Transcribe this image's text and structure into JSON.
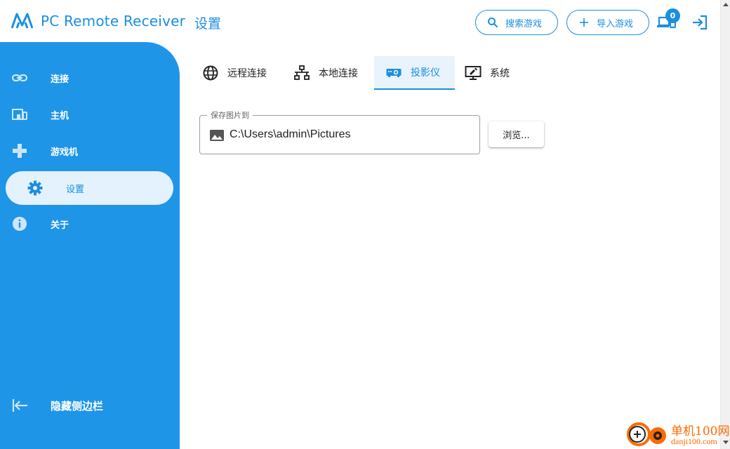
{
  "header": {
    "app_title": "PC Remote Receiver",
    "page_title": "设置",
    "search_games_label": "搜索游戏",
    "import_games_label": "导入游戏",
    "devices_badge_count": "0"
  },
  "sidebar": {
    "items": [
      {
        "label": "连接",
        "icon": "link-icon"
      },
      {
        "label": "主机",
        "icon": "host-devices-icon"
      },
      {
        "label": "游戏机",
        "icon": "gamepad-icon"
      },
      {
        "label": "设置",
        "icon": "gear-icon",
        "active": true
      },
      {
        "label": "关于",
        "icon": "info-icon"
      }
    ],
    "hide_sidebar_label": "隐藏侧边栏"
  },
  "tabs": [
    {
      "label": "远程连接",
      "icon": "globe-icon"
    },
    {
      "label": "本地连接",
      "icon": "network-icon"
    },
    {
      "label": "投影仪",
      "icon": "projector-icon",
      "active": true
    },
    {
      "label": "系统",
      "icon": "monitor-settings-icon"
    }
  ],
  "projector": {
    "save_path_label": "保存图片到",
    "save_path_value": "C:\\Users\\admin\\Pictures",
    "browse_label": "浏览..."
  },
  "watermark": {
    "title": "单机100网",
    "url": "danji100.com"
  },
  "colors": {
    "accent": "#1a8fe0",
    "sidebar_bg": "#1f95e8",
    "active_item_bg": "#e3f2fd",
    "watermark": "#ff6a00"
  }
}
